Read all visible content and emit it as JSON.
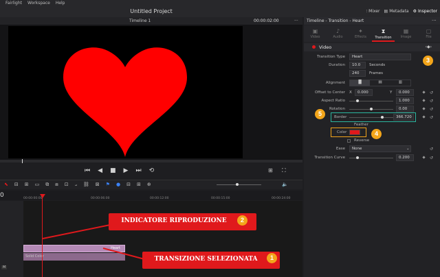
{
  "menu": {
    "items": [
      "Fairlight",
      "Workspace",
      "Help"
    ]
  },
  "project": {
    "title": "Untitled Project"
  },
  "header_buttons": {
    "mixer": "Mixer",
    "metadata": "Metadata",
    "inspector": "Inspector"
  },
  "timeline": {
    "name": "Timeline 1",
    "timecode": "00:00:02:00",
    "start": "0",
    "ruler": [
      "00:00:00:00",
      "00:00:06:00",
      "00:00:12:00",
      "00:00:15:00",
      "00:00:24:00"
    ]
  },
  "inspector": {
    "title": "Timeline - Transition - Heart",
    "tabs": [
      "Video",
      "Audio",
      "Effects",
      "Transition",
      "Image",
      "File"
    ],
    "active_tab": "Transition",
    "section": "Video",
    "transition_type_label": "Transition Type",
    "transition_type": "Heart",
    "duration_label": "Duration",
    "duration_seconds": "10.0",
    "seconds_unit": "Seconds",
    "duration_frames": "240",
    "frames_unit": "Frames",
    "alignment_label": "Alignment",
    "offset_label": "Offset to Center",
    "offset_x_label": "X",
    "offset_x": "0.000",
    "offset_y_label": "Y",
    "offset_y": "0.000",
    "aspect_label": "Aspect Ratio",
    "aspect": "1.000",
    "rotation_label": "Rotation",
    "rotation": "0.00",
    "border_label": "Border",
    "border": "366.720",
    "feather_label": "Feather",
    "color_label": "Color",
    "color_value": "#e0191c",
    "reverse_label": "Reverse",
    "ease_label": "Ease",
    "ease": "None",
    "curve_label": "Transition Curve",
    "curve": "0.200"
  },
  "clips": {
    "transition": "Heart",
    "clip": "Solid Color"
  },
  "callouts": {
    "playhead": "INDICATORE RIPRODUZIONE",
    "transition": "TRANSIZIONE SELEZIONATA",
    "badges": [
      "1",
      "2",
      "3",
      "4",
      "5"
    ]
  },
  "colors": {
    "accent": "#e0191c",
    "badge": "#f3a51a",
    "border_highlight": "#2bb6a0",
    "clip": "#b58ab7"
  }
}
